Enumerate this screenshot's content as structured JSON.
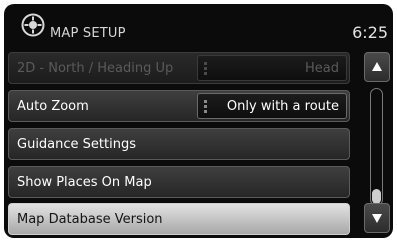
{
  "header": {
    "title": "MAP SETUP",
    "time": "6:25",
    "icon": "gear-icon"
  },
  "menu": {
    "items": [
      {
        "label": "2D - North / Heading Up",
        "value": "Head",
        "state": "disabled"
      },
      {
        "label": "Auto Zoom",
        "value": "Only with a route",
        "state": "normal"
      },
      {
        "label": "Guidance Settings",
        "state": "normal"
      },
      {
        "label": "Show Places On Map",
        "state": "normal"
      },
      {
        "label": "Map Database Version",
        "state": "selected"
      }
    ]
  },
  "scrollbar": {
    "up_icon": "up-arrow-icon",
    "down_icon": "down-arrow-icon",
    "position": 1.0
  }
}
